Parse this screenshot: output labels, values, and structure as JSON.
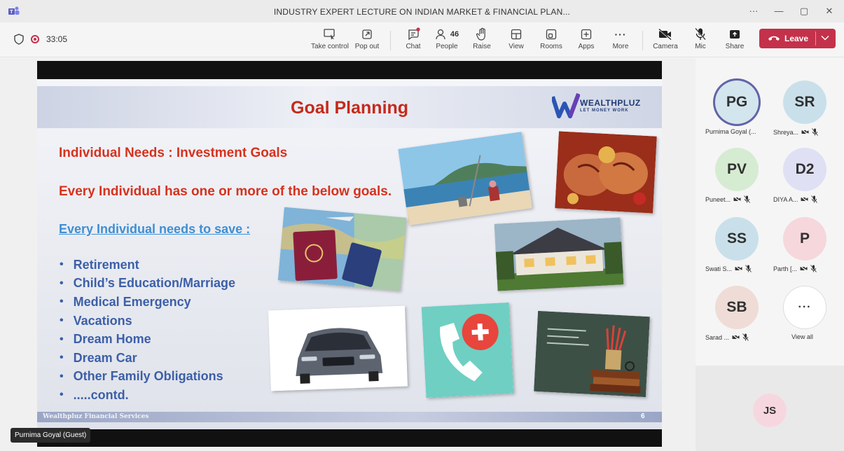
{
  "window": {
    "title": "INDUSTRY EXPERT LECTURE ON INDIAN MARKET & FINANCIAL PLAN...",
    "more_glyph": "···",
    "minimize_glyph": "—",
    "restore_glyph": "▢",
    "close_glyph": "✕"
  },
  "meeting": {
    "timer": "33:05",
    "participant_count": "46"
  },
  "toolbar": {
    "take_control": "Take control",
    "pop_out": "Pop out",
    "chat": "Chat",
    "people": "People",
    "raise": "Raise",
    "view": "View",
    "rooms": "Rooms",
    "apps": "Apps",
    "more": "More",
    "camera": "Camera",
    "mic": "Mic",
    "share": "Share",
    "leave": "Leave"
  },
  "slide": {
    "title": "Goal Planning",
    "logo_brand": "WEALTHPLUZ",
    "logo_tagline": "LET MONEY WORK",
    "heading1": "Individual  Needs : Investment Goals",
    "heading2": "Every Individual has one or more of the below goals.",
    "link_text": "Every Individual needs to save :",
    "bullets": [
      "Retirement",
      "Child’s Education/Marriage",
      "Medical Emergency",
      "Vacations",
      "Dream Home",
      "Dream Car",
      "Other Family Obligations",
      ".....contd."
    ],
    "footer_text": "Wealthpluz Financial Services",
    "page_number": "6"
  },
  "presenter_label": "Purnima Goyal (Guest)",
  "participants": [
    {
      "initials": "PG",
      "name": "Purnima Goyal (...",
      "color": "#c9e0ea",
      "active": true
    },
    {
      "initials": "SR",
      "name": "Shreya...",
      "color": "#c9e0ea",
      "active": false
    },
    {
      "initials": "PV",
      "name": "Puneet...",
      "color": "#d6ecd2",
      "active": false
    },
    {
      "initials": "D2",
      "name": "DIYA A...",
      "color": "#dfe0f4",
      "active": false
    },
    {
      "initials": "SS",
      "name": "Swati S...",
      "color": "#c9e0ea",
      "active": false
    },
    {
      "initials": "P",
      "name": "Parth [...",
      "color": "#f6d7dc",
      "active": false
    },
    {
      "initials": "SB",
      "name": "Sarad ...",
      "color": "#efdcd6",
      "active": false
    }
  ],
  "view_all": {
    "glyph": "···",
    "label": "View all"
  },
  "self": {
    "initials": "JS"
  },
  "colors": {
    "leave": "#c4314b",
    "active_ring": "#6264a7",
    "slide_title": "#c42a1c",
    "bullet": "#3c5fa8"
  }
}
